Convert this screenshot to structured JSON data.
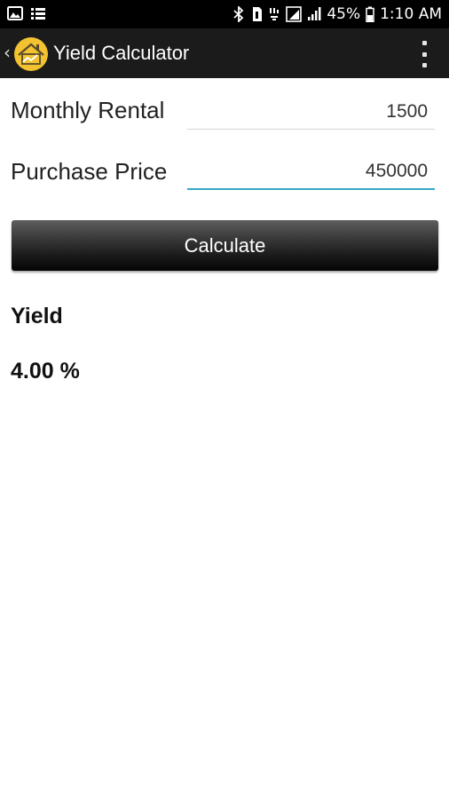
{
  "status_bar": {
    "left_icons": [
      "gallery-notification-icon",
      "list-notification-icon"
    ],
    "right_icons": [
      "bluetooth-icon",
      "sim-icon",
      "mobile-data-icon",
      "signal-icon",
      "signal-2-icon",
      "battery-icon"
    ],
    "battery": "45%",
    "time": "1:10 AM"
  },
  "action_bar": {
    "title": "Yield Calculator",
    "logo": "house-chart-logo",
    "colors": {
      "background": "#1b1b1b",
      "logo_circle": "#f2c230"
    }
  },
  "form": {
    "monthly_rental": {
      "label": "Monthly Rental",
      "value": "1500"
    },
    "purchase_price": {
      "label": "Purchase Price",
      "value": "450000"
    },
    "accent_color": "#35a9c6"
  },
  "calculate_button": {
    "label": "Calculate"
  },
  "result": {
    "heading": "Yield",
    "value": "4.00 %"
  }
}
